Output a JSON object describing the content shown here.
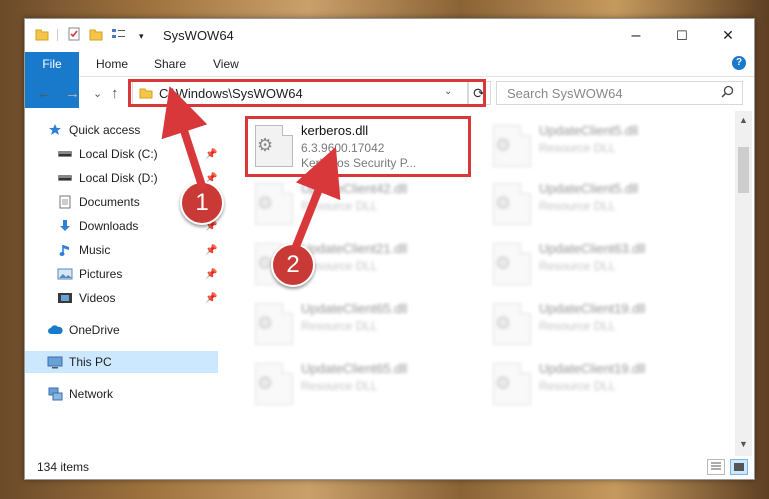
{
  "window": {
    "title": "SysWOW64",
    "minimize": "–",
    "maximize": "☐",
    "close": "✕"
  },
  "ribbon": {
    "file": "File",
    "home": "Home",
    "share": "Share",
    "view": "View"
  },
  "nav": {
    "back": "←",
    "forward": "→",
    "recent": "⌄",
    "up": "↑"
  },
  "address": {
    "path": "C:\\Windows\\SysWOW64",
    "dropdown": "⌄",
    "refresh": "⟳"
  },
  "search": {
    "placeholder": "Search SysWOW64",
    "icon": "search-icon"
  },
  "sidebar": {
    "items": [
      {
        "label": "Quick access",
        "icon": "star-icon"
      },
      {
        "label": "Local Disk (C:)",
        "icon": "drive-icon",
        "pinned": true
      },
      {
        "label": "Local Disk (D:)",
        "icon": "drive-icon",
        "pinned": true
      },
      {
        "label": "Documents",
        "icon": "documents-icon",
        "pinned": true
      },
      {
        "label": "Downloads",
        "icon": "downloads-icon",
        "pinned": true
      },
      {
        "label": "Music",
        "icon": "music-icon",
        "pinned": true
      },
      {
        "label": "Pictures",
        "icon": "pictures-icon",
        "pinned": true
      },
      {
        "label": "Videos",
        "icon": "videos-icon",
        "pinned": true
      },
      {
        "label": "OneDrive",
        "icon": "cloud-icon"
      },
      {
        "label": "This PC",
        "icon": "computer-icon",
        "selected": true
      },
      {
        "label": "Network",
        "icon": "network-icon"
      }
    ]
  },
  "files": [
    {
      "name": "kerberos.dll",
      "line1": "6.3.9600.17042",
      "line2": "Kerberos Security P..."
    },
    {
      "name": "UpdateClient5.dll",
      "line1": "Resource DLL"
    },
    {
      "name": "UpdateClient42.dll",
      "line1": "Resource DLL"
    },
    {
      "name": "UpdateClient5.dll",
      "line1": "Resource DLL"
    },
    {
      "name": "UpdateClient21.dll",
      "line1": "Resource DLL"
    },
    {
      "name": "UpdateClient63.dll",
      "line1": "Resource DLL"
    },
    {
      "name": "UpdateClient65.dll",
      "line1": "Resource DLL"
    },
    {
      "name": "UpdateClient19.dll",
      "line1": "Resource DLL"
    },
    {
      "name": "UpdateClient65.dll",
      "line1": "Resource DLL"
    },
    {
      "name": "UpdateClient19.dll",
      "line1": "Resource DLL"
    }
  ],
  "status": {
    "count": "134 items"
  },
  "markers": {
    "one": "1",
    "two": "2"
  },
  "colors": {
    "accent": "#1979ca",
    "highlight": "#d9383a",
    "selected": "#cce8ff"
  }
}
